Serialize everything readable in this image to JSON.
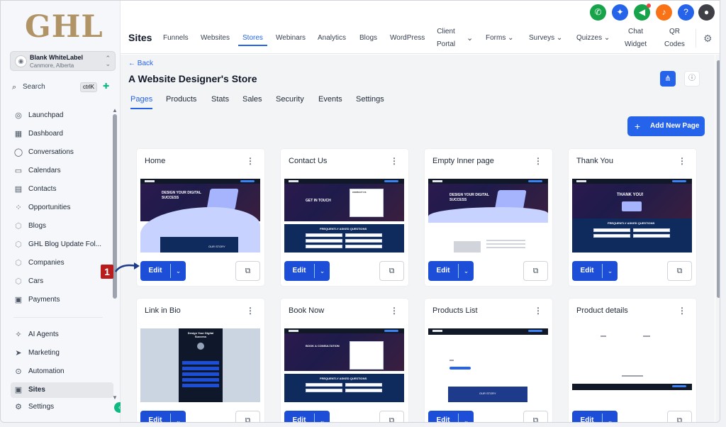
{
  "brand": {
    "logo": "GHL"
  },
  "account": {
    "name": "Blank WhiteLabel",
    "location": "Canmore, Alberta"
  },
  "search": {
    "label": "Search",
    "shortcut": "ctrlK"
  },
  "sidebar": {
    "items": [
      {
        "label": "Launchpad",
        "icon": "rocket-icon"
      },
      {
        "label": "Dashboard",
        "icon": "grid-icon"
      },
      {
        "label": "Conversations",
        "icon": "chat-icon"
      },
      {
        "label": "Calendars",
        "icon": "calendar-icon"
      },
      {
        "label": "Contacts",
        "icon": "contacts-icon"
      },
      {
        "label": "Opportunities",
        "icon": "opportunities-icon"
      },
      {
        "label": "Blogs",
        "icon": "cube-icon"
      },
      {
        "label": "GHL Blog Update Fol...",
        "icon": "cube-icon"
      },
      {
        "label": "Companies",
        "icon": "cube-icon"
      },
      {
        "label": "Cars",
        "icon": "cube-icon"
      },
      {
        "label": "Payments",
        "icon": "payments-icon"
      }
    ],
    "items2": [
      {
        "label": "AI Agents",
        "icon": "sparkle-icon"
      },
      {
        "label": "Marketing",
        "icon": "send-icon"
      },
      {
        "label": "Automation",
        "icon": "automation-icon"
      },
      {
        "label": "Sites",
        "icon": "sites-icon"
      },
      {
        "label": "Settings",
        "icon": "gear-icon"
      }
    ]
  },
  "topnav": {
    "title": "Sites",
    "items": [
      "Funnels",
      "Websites",
      "Stores",
      "Webinars",
      "Analytics",
      "Blogs",
      "WordPress"
    ],
    "client_portal": [
      "Client",
      "Portal"
    ],
    "forms": "Forms",
    "surveys": "Surveys",
    "quizzes": "Quizzes",
    "chat_widget": [
      "Chat",
      "Widget"
    ],
    "qr_codes": [
      "QR",
      "Codes"
    ],
    "active": "Stores"
  },
  "topicons": {
    "colors": {
      "phone": "#16a34a",
      "magic": "#2563eb",
      "megaphone": "#16a34a",
      "bell": "#f97316",
      "help": "#2563eb"
    }
  },
  "page": {
    "back": "← Back",
    "title": "A Website Designer's Store",
    "tabs": [
      "Pages",
      "Products",
      "Stats",
      "Sales",
      "Security",
      "Events",
      "Settings"
    ],
    "add_button": "Add New Page",
    "edit_label": "Edit"
  },
  "cards": [
    {
      "title": "Home"
    },
    {
      "title": "Contact Us"
    },
    {
      "title": "Empty Inner page"
    },
    {
      "title": "Thank You"
    },
    {
      "title": "Link in Bio"
    },
    {
      "title": "Book Now"
    },
    {
      "title": "Products List"
    },
    {
      "title": "Product details"
    }
  ],
  "thumb_text": {
    "design": "DESIGN YOUR DIGITAL SUCCESS",
    "touch": "GET IN TOUCH",
    "contact": "CONTACT US",
    "faq": "FREQUENTLY ASKED QUESTIONS",
    "thanks": "THANK YOU!",
    "story": "OUR STORY",
    "bio": "Design Your Digital Success",
    "book": "BOOK A CONSULTATION"
  },
  "annotation": {
    "number": "1"
  },
  "accent": "#2563eb"
}
